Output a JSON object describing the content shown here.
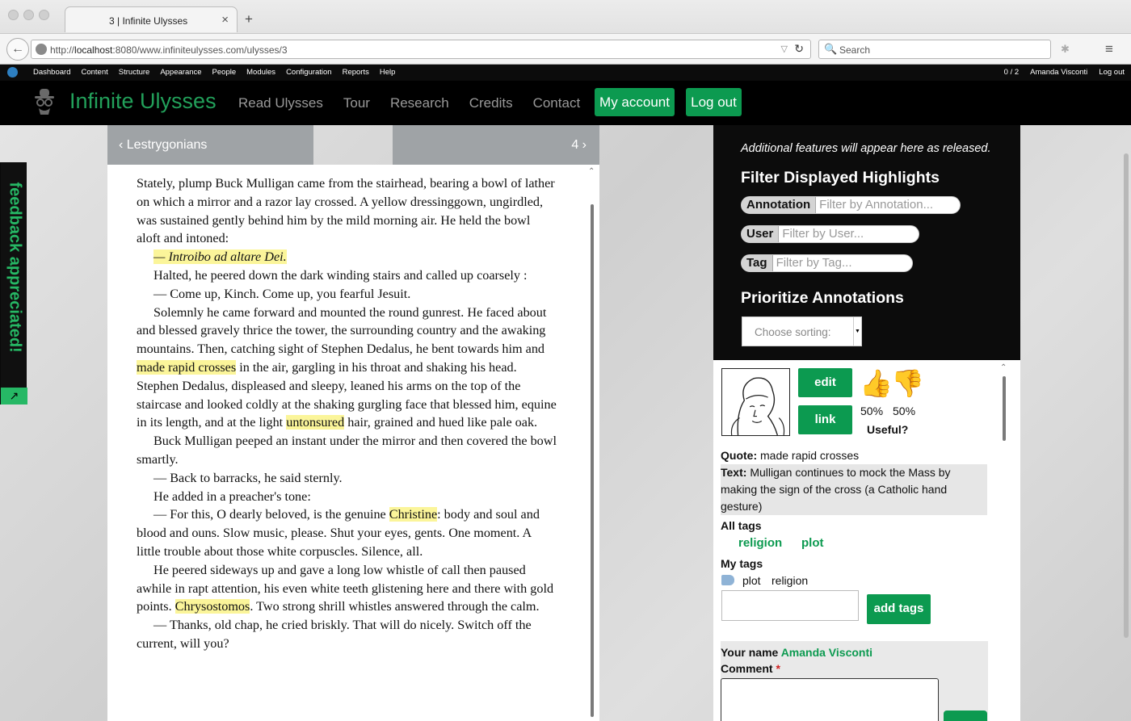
{
  "browser": {
    "tab_title": "3 | Infinite Ulysses",
    "tab_close": "×",
    "new_tab": "+",
    "back": "←",
    "url_prefix": "http://",
    "url_host": "localhost",
    "url_rest": ":8080/www.infiniteulysses.com/ulysses/3",
    "url_dropdown": "▽",
    "reload": "↻",
    "search_placeholder": "Search",
    "search_icon": "🔍",
    "menu_icon": "≡",
    "extension_icon": "✱"
  },
  "admin_toolbar": {
    "items": [
      "Dashboard",
      "Content",
      "Structure",
      "Appearance",
      "People",
      "Modules",
      "Configuration",
      "Reports",
      "Help"
    ],
    "counter": "0 / 2",
    "user": "Amanda Visconti",
    "logout": "Log out"
  },
  "site": {
    "name": "Infinite Ulysses",
    "nav": [
      "Read Ulysses",
      "Tour",
      "Research",
      "Credits",
      "Contact"
    ],
    "my_account": "My account",
    "log_out": "Log out"
  },
  "feedback": {
    "label": "feedback appreciated!",
    "icon": "↗"
  },
  "chapter_nav": {
    "prev": "‹ Lestrygonians",
    "next": "4 ›"
  },
  "reader": {
    "p1": "Stately, plump Buck Mulligan came from the stairhead, bearing a bowl of lather on which a mirror and a razor lay crossed. A yellow dressinggown, ungirdled, was sustained gently behind him by the mild morning air. He held the bowl aloft and intoned:",
    "p2": "— Introibo ad altare Dei.",
    "p3": "Halted, he peered down the dark winding stairs and called up coarsely :",
    "p4": "— Come up, Kinch. Come up, you fearful Jesuit.",
    "p5a": "Solemnly he came forward and mounted the round gunrest. He faced about and blessed gravely thrice the tower, the surrounding country and the awaking mountains. Then, catching sight of Stephen Dedalus, he bent towards him and ",
    "p5h1": "made rapid crosses",
    "p5b": " in the air, gargling in his throat and shaking his head. Stephen Dedalus, displeased and sleepy, leaned his arms on the top of the staircase and looked coldly at the shaking gurgling face that blessed him, equine in its length, and at the light ",
    "p5h2": "untonsured",
    "p5c": " hair, grained and hued like pale oak.",
    "p6": "Buck Mulligan peeped an instant under the mirror and then covered the bowl smartly.",
    "p7": "— Back to barracks, he said sternly.",
    "p8": "He added in a preacher's tone:",
    "p9a": "— For this, O dearly beloved, is the genuine ",
    "p9h": "Christine",
    "p9b": ": body and soul and blood and ouns. Slow music, please. Shut your eyes, gents. One moment. A little trouble about those white corpuscles. Silence, all.",
    "p10a": "He peered sideways up and gave a long low whistle of call then paused awhile in rapt attention, his even white teeth glistening here and there with gold points. ",
    "p10h": "Chrysostomos",
    "p10b": ". Two strong shrill whistles answered through the calm.",
    "p11": "— Thanks, old chap, he cried briskly. That will do nicely. Switch off the current, will you?"
  },
  "right_panel": {
    "info": "Additional features will appear here as released.",
    "filter_heading": "Filter Displayed Highlights",
    "filters": [
      {
        "label": "Annotation",
        "placeholder": "Filter by Annotation..."
      },
      {
        "label": "User",
        "placeholder": "Filter by User..."
      },
      {
        "label": "Tag",
        "placeholder": "Filter by Tag..."
      }
    ],
    "prioritize_heading": "Prioritize Annotations",
    "sort_placeholder": "Choose sorting:"
  },
  "annotation": {
    "edit": "edit",
    "link": "link",
    "thumbs_up_icon": "👍",
    "thumbs_down_icon": "👎",
    "up_pct": "50%",
    "down_pct": "50%",
    "useful": "Useful?",
    "quote_label": "Quote:",
    "quote": "made rapid crosses",
    "text_label": "Text:",
    "text": "Mulligan continues to mock the Mass by making the sign of the cross (a Catholic hand gesture)",
    "all_tags_label": "All tags",
    "all_tags": [
      "religion",
      "plot"
    ],
    "my_tags_label": "My tags",
    "my_tags": [
      "plot",
      "religion"
    ],
    "add_tags": "add tags",
    "your_name_label": "Your name",
    "your_name": "Amanda Visconti",
    "comment_label": "Comment",
    "required": "*"
  },
  "colors": {
    "brand_green": "#0c9a50",
    "highlight": "#fbf59a",
    "dark_bg": "#0c0c0c",
    "chapter_nav": "#9fa3a6"
  }
}
